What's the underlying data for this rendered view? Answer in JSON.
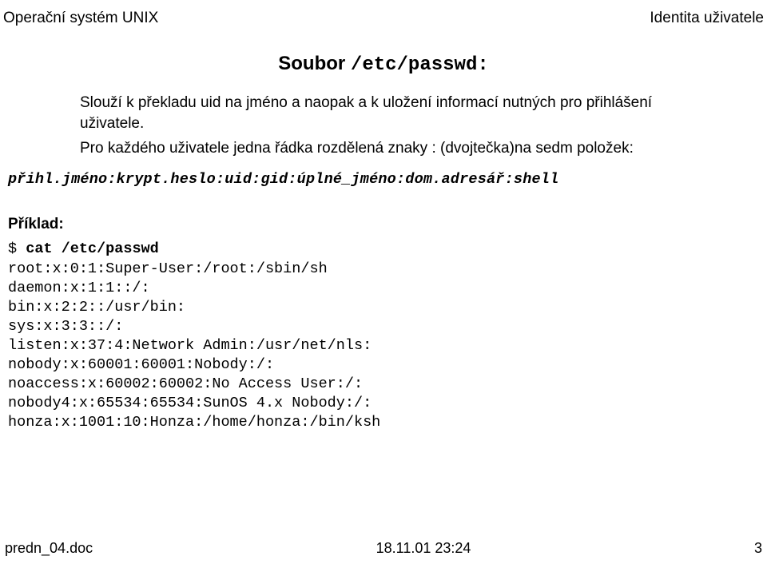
{
  "header": {
    "left": "Operační systém UNIX",
    "right": "Identita uživatele"
  },
  "title": {
    "word": "Soubor",
    "path": "/etc/passwd:"
  },
  "para1": "Slouží k překladu uid na jméno a naopak a k uložení informací nutných pro přihlášení uživatele.",
  "para2": "Pro každého uživatele jedna řádka rozdělená znaky : (dvojtečka)na sedm položek:",
  "format_line": "přihl.jméno:krypt.heslo:uid:gid:úplné_jméno:dom.adresář:shell",
  "example": {
    "label": "Příklad:",
    "prompt": "$ ",
    "cmd": "cat /etc/passwd",
    "lines": [
      "root:x:0:1:Super-User:/root:/sbin/sh",
      "daemon:x:1:1::/:",
      "bin:x:2:2::/usr/bin:",
      "sys:x:3:3::/:",
      "listen:x:37:4:Network Admin:/usr/net/nls:",
      "nobody:x:60001:60001:Nobody:/:",
      "noaccess:x:60002:60002:No Access User:/:",
      "nobody4:x:65534:65534:SunOS 4.x Nobody:/:",
      "honza:x:1001:10:Honza:/home/honza:/bin/ksh"
    ]
  },
  "footer": {
    "left": "predn_04.doc",
    "center": "18.11.01 23:24",
    "right": "3"
  }
}
